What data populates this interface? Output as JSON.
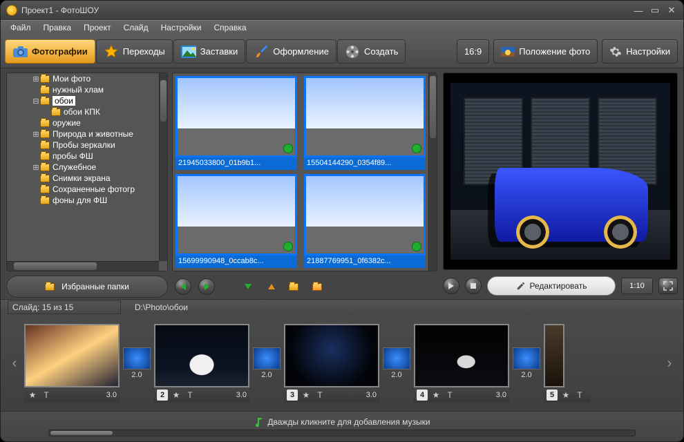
{
  "title": "Проект1 - ФотоШОУ",
  "menu": {
    "items": [
      "Файл",
      "Правка",
      "Проект",
      "Слайд",
      "Настройки",
      "Справка"
    ]
  },
  "tabs": {
    "items": [
      {
        "label": "Фотографии",
        "icon": "camera",
        "active": true
      },
      {
        "label": "Переходы",
        "icon": "star",
        "active": false
      },
      {
        "label": "Заставки",
        "icon": "picture",
        "active": false
      },
      {
        "label": "Оформление",
        "icon": "brush",
        "active": false
      },
      {
        "label": "Создать",
        "icon": "reel",
        "active": false
      }
    ]
  },
  "toolbar_right": {
    "aspect": "16:9",
    "position_label": "Положение фото",
    "settings_label": "Настройки"
  },
  "tree": {
    "rows": [
      {
        "indent": 2,
        "exp": "+",
        "label": "Мои фото"
      },
      {
        "indent": 2,
        "exp": "",
        "label": "нужный хлам"
      },
      {
        "indent": 2,
        "exp": "-",
        "label": "обои",
        "selected": true
      },
      {
        "indent": 3,
        "exp": "",
        "label": "обои КПК"
      },
      {
        "indent": 2,
        "exp": "",
        "label": "оружие"
      },
      {
        "indent": 2,
        "exp": "+",
        "label": "Природа и животные"
      },
      {
        "indent": 2,
        "exp": "",
        "label": "Пробы зеркалки"
      },
      {
        "indent": 2,
        "exp": "",
        "label": "пробы ФШ"
      },
      {
        "indent": 2,
        "exp": "+",
        "label": "Служебное"
      },
      {
        "indent": 2,
        "exp": "",
        "label": "Снимки экрана"
      },
      {
        "indent": 2,
        "exp": "",
        "label": "Сохраненные фотогр"
      },
      {
        "indent": 2,
        "exp": "",
        "label": "фоны для ФШ"
      }
    ],
    "fav_label": "Избранные папки"
  },
  "grid": {
    "items": [
      {
        "caption": "21945033800_01b9b1..."
      },
      {
        "caption": "15504144290_0354f89..."
      },
      {
        "caption": "15699990948_0ccab8c..."
      },
      {
        "caption": "21887769951_0f6382c..."
      }
    ]
  },
  "preview": {
    "edit_label": "Редактировать",
    "time": "1:10"
  },
  "info": {
    "slide_counter": "Слайд: 15 из 15",
    "path": "D:\\Photo\\обои"
  },
  "timeline": {
    "slides": [
      {
        "num": "",
        "dur": "3.0",
        "variant": "sunset"
      },
      {
        "num": "2",
        "dur": "3.0",
        "variant": "whitecar"
      },
      {
        "num": "3",
        "dur": "3.0",
        "variant": "dark"
      },
      {
        "num": "4",
        "dur": "3.0",
        "variant": "blackcar"
      },
      {
        "num": "5",
        "dur": "",
        "variant": "edge"
      }
    ],
    "trans_dur": "2.0"
  },
  "music": {
    "hint": "Дважды кликните для добавления музыки"
  }
}
